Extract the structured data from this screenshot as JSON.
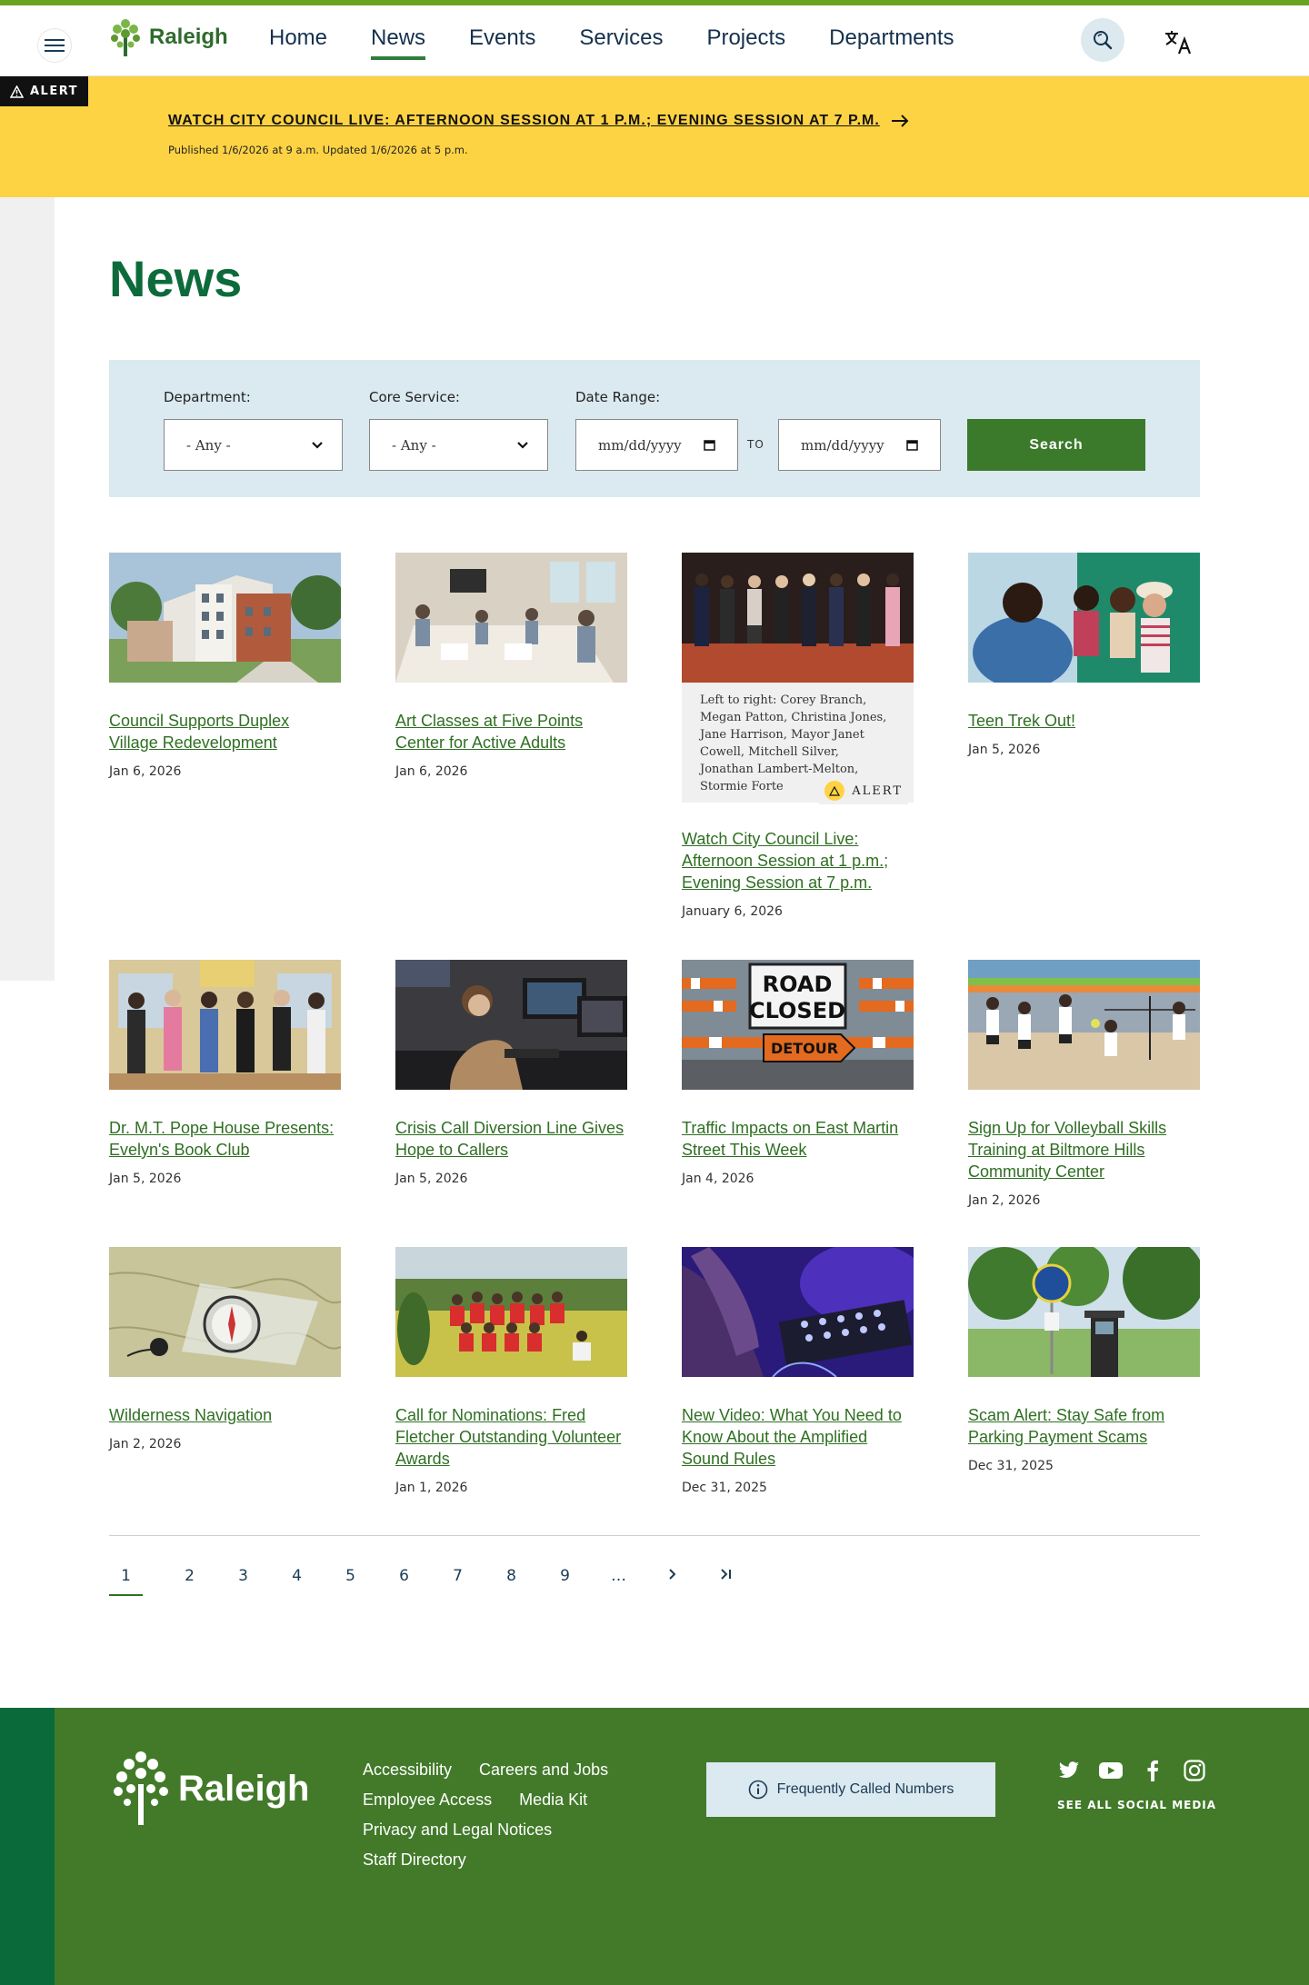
{
  "header": {
    "brand": "Raleigh",
    "nav": [
      {
        "label": "Home"
      },
      {
        "label": "News"
      },
      {
        "label": "Events"
      },
      {
        "label": "Services"
      },
      {
        "label": "Projects"
      },
      {
        "label": "Departments"
      }
    ],
    "active_nav": "News",
    "search_icon": "search-icon",
    "translate_icon": "translate-icon",
    "menu_icon": "hamburger-icon"
  },
  "alert": {
    "badge": "ALERT",
    "headline": "WATCH CITY COUNCIL LIVE: AFTERNOON SESSION AT 1 P.M.; EVENING SESSION AT 7 P.M.",
    "meta": "Published 1/6/2026 at 9 a.m.  Updated 1/6/2026 at 5 p.m."
  },
  "page": {
    "title": "News"
  },
  "filters": {
    "department_label": "Department:",
    "department_value": "- Any -",
    "core_service_label": "Core Service:",
    "core_service_value": "- Any -",
    "date_range_label": "Date Range:",
    "date_from_placeholder": "mm/dd/yyyy",
    "date_to_placeholder": "mm/dd/yyyy",
    "to_label": "TO",
    "search_label": "Search"
  },
  "articles": [
    {
      "title": "Council Supports Duplex Village Redevelopment",
      "date": "Jan 6, 2026"
    },
    {
      "title": "Art Classes at Five Points Center for Active Adults",
      "date": "Jan 6, 2026"
    },
    {
      "title": "Watch City Council Live: Afternoon Session at 1 p.m.; Evening Session at 7 p.m.",
      "date": "January 6, 2026",
      "caption": "Left to right: Corey Branch, Megan Patton, Christina Jones, Jane Harrison, Mayor Janet Cowell, Mitchell Silver, Jonathan Lambert-Melton, Stormie Forte",
      "caption_badge": "ALERT"
    },
    {
      "title": "Teen Trek Out!",
      "date": "Jan 5, 2026"
    },
    {
      "title": "Dr. M.T. Pope House Presents: Evelyn's Book Club",
      "date": "Jan 5, 2026"
    },
    {
      "title": "Crisis Call Diversion Line Gives Hope to Callers",
      "date": "Jan 5, 2026"
    },
    {
      "title": "Traffic Impacts on East Martin Street This Week",
      "date": "Jan 4, 2026",
      "sign_top": "ROAD",
      "sign_bottom": "CLOSED",
      "sign_arrow": "DETOUR"
    },
    {
      "title": "Sign Up for Volleyball Skills Training at Biltmore Hills Community Center",
      "date": "Jan 2, 2026"
    },
    {
      "title": "Wilderness Navigation",
      "date": "Jan 2, 2026"
    },
    {
      "title": "Call for Nominations: Fred Fletcher Outstanding Volunteer Awards",
      "date": "Jan 1, 2026"
    },
    {
      "title": "New Video: What You Need to Know About the Amplified Sound Rules",
      "date": "Dec 31, 2025"
    },
    {
      "title": "Scam Alert: Stay Safe from Parking Payment Scams",
      "date": "Dec 31, 2025"
    }
  ],
  "pagination": {
    "pages": [
      "1",
      "2",
      "3",
      "4",
      "5",
      "6",
      "7",
      "8",
      "9",
      "…"
    ],
    "current": "1",
    "next_icon": "chevron-right-icon",
    "last_icon": "last-page-icon"
  },
  "footer": {
    "brand": "Raleigh",
    "links": [
      {
        "label": "Accessibility"
      },
      {
        "label": "Careers and Jobs"
      },
      {
        "label": "Employee Access"
      },
      {
        "label": "Media Kit"
      },
      {
        "label": "Privacy and Legal Notices"
      },
      {
        "label": "Staff Directory"
      }
    ],
    "frequently_called": "Frequently Called Numbers",
    "social_icons": [
      "twitter-icon",
      "youtube-icon",
      "facebook-icon",
      "instagram-icon"
    ],
    "see_all_social": "SEE ALL SOCIAL MEDIA"
  },
  "colors": {
    "brand_green": "#0d6b3b",
    "link_green": "#2f6f22",
    "alert_yellow": "#fed343",
    "filter_bg": "#dbe9f0",
    "footer_green": "#427a2a",
    "navy": "#15314d"
  }
}
